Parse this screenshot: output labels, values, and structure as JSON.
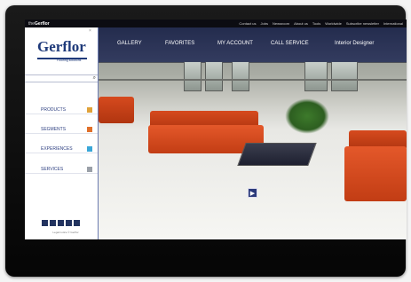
{
  "topbar": {
    "brand_prefix": "the",
    "brand_name": "Gerflor",
    "links": [
      "Contact us",
      "Jobs",
      "Newsroom",
      "About us",
      "Tools",
      "Worldwide",
      "Subscribe newsletter",
      "International"
    ]
  },
  "sidebar": {
    "close_glyph": "×",
    "logo": "Gerflor",
    "tagline": "Flooring solutions",
    "search": {
      "placeholder": "",
      "icon": "search-icon"
    },
    "menu": [
      {
        "label": "PRODUCTS",
        "color": "#e0a23a"
      },
      {
        "label": "SEGMENTS",
        "color": "#e0702a"
      },
      {
        "label": "EXPERIENCES",
        "color": "#3aa7d8"
      },
      {
        "label": "SERVICES",
        "color": "#9aa0a8"
      }
    ],
    "social_icons": [
      "facebook-icon",
      "twitter-icon",
      "linkedin-icon",
      "youtube-icon",
      "rss-icon"
    ],
    "footer": "Legal notice © Gerflor"
  },
  "nav": {
    "items": [
      "GALLERY",
      "FAVORITES",
      "MY ACCOUNT",
      "CALL SERVICE",
      "Interior Designer"
    ]
  },
  "content": {
    "play_glyph": "▶",
    "colors": {
      "accent": "#1f3a7a",
      "sofa": "#d24a1c"
    }
  }
}
